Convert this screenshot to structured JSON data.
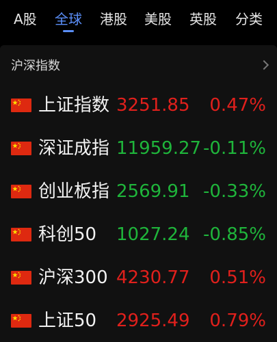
{
  "tabs": [
    {
      "label": "A股",
      "active": false
    },
    {
      "label": "全球",
      "active": true
    },
    {
      "label": "港股",
      "active": false
    },
    {
      "label": "美股",
      "active": false
    },
    {
      "label": "英股",
      "active": false
    },
    {
      "label": "分类",
      "active": false
    }
  ],
  "section": {
    "title": "沪深指数",
    "icon": "chevron-right-icon"
  },
  "colors": {
    "up": "#e0201c",
    "down": "#1fb53b",
    "accent": "#5b8ff9"
  },
  "indices": [
    {
      "name": "上证指数",
      "price": "3251.85",
      "change": "0.47%",
      "direction": "up",
      "flag": "china-flag-icon"
    },
    {
      "name": "深证成指",
      "price": "11959.27",
      "change": "-0.11%",
      "direction": "down",
      "flag": "china-flag-icon"
    },
    {
      "name": "创业板指",
      "price": "2569.91",
      "change": "-0.33%",
      "direction": "down",
      "flag": "china-flag-icon"
    },
    {
      "name": "科创50",
      "price": "1027.24",
      "change": "-0.85%",
      "direction": "down",
      "flag": "china-flag-icon"
    },
    {
      "name": "沪深300",
      "price": "4230.77",
      "change": "0.51%",
      "direction": "up",
      "flag": "china-flag-icon"
    },
    {
      "name": "上证50",
      "price": "2925.49",
      "change": "0.79%",
      "direction": "up",
      "flag": "china-flag-icon"
    }
  ]
}
